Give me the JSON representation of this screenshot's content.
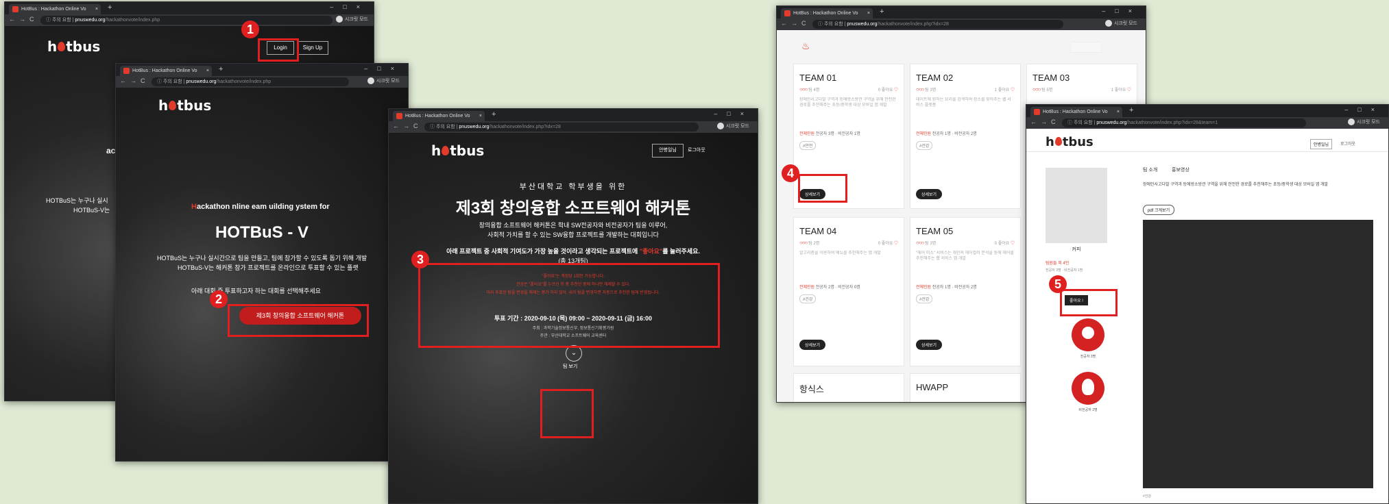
{
  "browser": {
    "tab_title": "HotBus : Hackathon Online Vo",
    "url_warning": "주의 요함",
    "profile_label": "시크릿 모드"
  },
  "step_badges": [
    "1",
    "2",
    "3",
    "4",
    "5"
  ],
  "win1": {
    "url_host": "pnuswedu.org",
    "url_path": "/hackathonvote/index.php",
    "logo": [
      "h",
      "tbus"
    ],
    "login": "Login",
    "signup": "Sign Up",
    "hero_partial": "ackath",
    "desc1": "HOTBuS는 누구나 실시",
    "desc2": "HOTBuS-V는"
  },
  "win2": {
    "url_host": "pnuswedu.org",
    "url_path": "/hackathonvote/index.php",
    "logo": [
      "h",
      "tbus"
    ],
    "system_title": "ackathon nline eam uilding ystem for",
    "system_title_initials": [
      "H",
      "O",
      "T",
      "Bu",
      "S"
    ],
    "main_title": "HOTBuS - V",
    "desc1": "HOTBuS는 누구나 실시간으로 팀을 만들고, 팀에 참가할 수 있도록 돕기 위해 개발",
    "desc2": "HOTBuS-V는 해커톤 참가 프로젝트를 온라인으로 투표할 수 있는 플랫",
    "select_prompt": "아래 대회 중 투표하고자 하는 대회를 선택해주세요",
    "contest_button": "제3회 창의융합 소프트웨어 해커톤"
  },
  "win3": {
    "url_host": "pnuswedu.org",
    "url_path": "/hackathonvote/index.php?idx=28",
    "logo": [
      "h",
      "tbus"
    ],
    "user_btn": "안병일님",
    "logout": "로그아웃",
    "subtitle": "부산대학교 학부생을 위한",
    "title": "제3회 창의융합 소프트웨어 해커톤",
    "intro1": "창의융합 소프트웨어 해커톤은 학내 SW전공자와 비전공자가 팀을 이루어,",
    "intro2": "사회적 가치를 할 수 있는 SW융합 프로젝트를 개발하는 대회입니다",
    "vote_prompt_a": "아래 프로젝트 중 사회적 기여도가 가장 높을 것이라고 생각되는 프로젝트에 ",
    "vote_prompt_like": "\"좋아요\"",
    "vote_prompt_b": "를 눌러주세요.",
    "vote_count": "(총 13개팀)",
    "rule1": "\"좋아요\"는 계정당 1회만 가능합니다.",
    "rule2": "전공은 \"좋아요\"를 누르신 뒤 총 추천단 중에 하나만 해제할 수 있다.",
    "rule3": "미리 투표한 팀을 변경을 해제는 평가 하지 않아, 내가 팀을 변경하면 자동으로 추천한 팀에 반영됩니다.",
    "period": "투표 기간 : 2020-09-10 (목) 09:00 ~ 2020-09-11 (금) 16:00",
    "host": "주최 : 과학기술정보통신부, 정보통신기획평가원",
    "org": "주관 : 부산대학교 소프트웨어 교육센터",
    "see_teams": "팀 보기"
  },
  "win4": {
    "url_host": "pnuswedu.org",
    "url_path": "/hackathonvote/index.php?idx=28",
    "teams": [
      {
        "name": "TEAM 01",
        "members": "팀 4명",
        "likes": "0 좋아요",
        "desc": "장애인사고다발 구역과 등에방소방관 구역을 위해 안전한 경로를 추천해주는 초등/중학생 대상 모바일 앱 개발",
        "roles": "전공자 3명 · 비전공자 1명",
        "tag": "#안전",
        "more": "상세보기"
      },
      {
        "name": "TEAM 02",
        "members": "팀 3명",
        "likes": "1 좋아요",
        "desc": "데이트에 원하는 요리를 검색하여 장소를 찾아주는 웹 서비스 플랫폼",
        "roles": "전공자 1명 · 비전공자 2명",
        "tag": "#건강",
        "more": "상세보기"
      },
      {
        "name": "TEAM 03",
        "members": "팀 5명",
        "likes": "1 좋아요",
        "desc": "",
        "roles": "",
        "tag": "",
        "more": ""
      },
      {
        "name": "TEAM 04",
        "members": "팀 2명",
        "likes": "0 좋아요",
        "desc": "알고리즘을 이용하여 메뉴를 추천해주는 앱 개발",
        "roles": "전공자 2명 · 비전공자 0명",
        "tag": "#건강",
        "more": "상세보기"
      },
      {
        "name": "TEAM 05",
        "members": "팀 3명",
        "likes": "0 좋아요",
        "desc": "\"헤어 미소\" 서비스는 개인의 헤어컬러 분석을 통해 헤어를 추천해주는 웹 서비스 앱 개발",
        "roles": "전공자 1명 · 비전공자 2명",
        "tag": "#건강",
        "more": "상세보기"
      },
      {
        "name": "항식스",
        "members": "",
        "likes": "",
        "desc": "",
        "roles": "",
        "tag": "",
        "more": ""
      },
      {
        "name": "HWAPP",
        "members": "",
        "likes": "",
        "desc": "",
        "roles": "",
        "tag": "",
        "more": ""
      }
    ]
  },
  "win5": {
    "url_host": "pnuswedu.org",
    "url_path": "/hackathonvote/index.php?idx=28&team=1",
    "logo": [
      "h",
      "tbus"
    ],
    "user_btn": "안병일님",
    "logout": "로그아웃",
    "tab_intro": "팀 소개",
    "tab_video": "홍보영상",
    "description": "장애인사고다발 구역과 등에방소방관 구역을 위해 안전한 경로를 추천해주는 초등/중학생 대상 모바일 앱 개발",
    "pdf_btn": "pdf 크게보기",
    "image_caption": "커피",
    "members_label": "팀원들 외 4인",
    "members_sub": "전공자 3명 · 비전공자 1명",
    "like_btn": "좋아요 !",
    "major_label": "전공자 3명",
    "nonmajor_label": "비전공자 2명",
    "footer_tag": "#건강",
    "colors": {
      "accent": "#e23a2b",
      "badge": "#e02020"
    }
  }
}
